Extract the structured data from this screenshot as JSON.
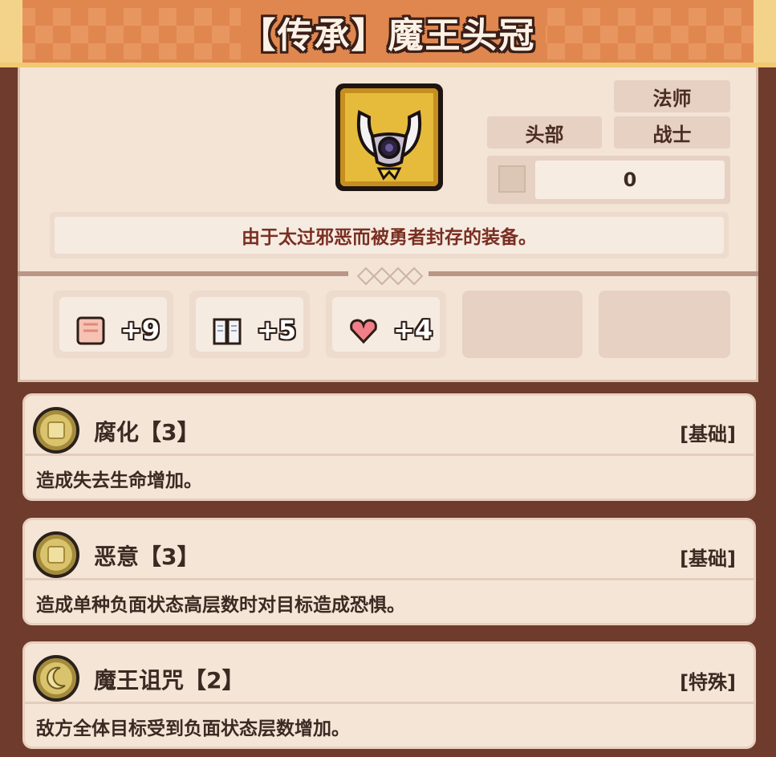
{
  "item": {
    "title": "【传承】魔王头冠",
    "description": "由于太过邪恶而被勇者封存的装备。",
    "slot": "头部",
    "classes": [
      "法师",
      "战士"
    ],
    "power_value": "0",
    "icon": "demon-king-crown-icon"
  },
  "stats": [
    {
      "icon": "fist-icon",
      "value": "+9"
    },
    {
      "icon": "book-icon",
      "value": "+5"
    },
    {
      "icon": "heart-icon",
      "value": "+4"
    }
  ],
  "skills": [
    {
      "name": "腐化【3】",
      "type": "[基础]",
      "text": "造成失去生命增加。",
      "icon": "corruption-icon"
    },
    {
      "name": "恶意【3】",
      "type": "[基础]",
      "text": "造成单种负面状态高层数时对目标造成恐惧。",
      "icon": "malice-icon"
    },
    {
      "name": "魔王诅咒【2】",
      "type": "[特殊]",
      "text": "敌方全体目标受到负面状态层数增加。",
      "icon": "moon-icon"
    }
  ],
  "colors": {
    "banner": "#e0874f",
    "card": "#f3e4d6",
    "frame": "#6e3b2c",
    "badge": "#d9c36c"
  }
}
